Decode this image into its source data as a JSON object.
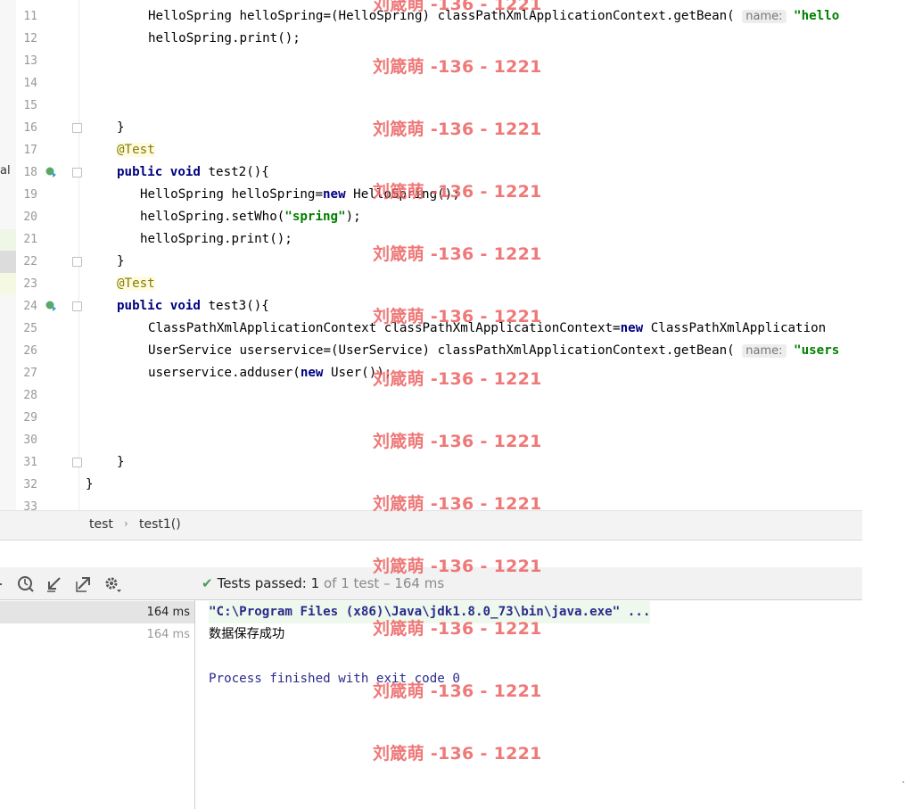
{
  "editor": {
    "left_glyph": "al",
    "lines": [
      {
        "n": "11",
        "indent": 70,
        "tokens": [
          {
            "t": "HelloSpring helloSpring=(HelloSpring) classPathXmlApplicationContext.getBean( ",
            "c": ""
          },
          {
            "t": "name:",
            "c": "hint"
          },
          {
            "t": " \"hello",
            "c": "str"
          }
        ]
      },
      {
        "n": "12",
        "indent": 70,
        "tokens": [
          {
            "t": "helloSpring.print();",
            "c": ""
          }
        ]
      },
      {
        "n": "13",
        "indent": 0,
        "tokens": []
      },
      {
        "n": "14",
        "indent": 0,
        "tokens": []
      },
      {
        "n": "15",
        "indent": 0,
        "tokens": []
      },
      {
        "n": "16",
        "indent": 35,
        "tokens": [
          {
            "t": "}",
            "c": ""
          }
        ]
      },
      {
        "n": "17",
        "indent": 35,
        "tokens": [
          {
            "t": "@Test",
            "c": "anno"
          }
        ]
      },
      {
        "n": "18",
        "indent": 35,
        "tokens": [
          {
            "t": "public ",
            "c": "kw"
          },
          {
            "t": "void ",
            "c": "kw"
          },
          {
            "t": "test2(){",
            "c": ""
          }
        ]
      },
      {
        "n": "19",
        "indent": 61,
        "tokens": [
          {
            "t": "HelloSpring helloSpring=",
            "c": ""
          },
          {
            "t": "new ",
            "c": "kw"
          },
          {
            "t": "HelloSpring();",
            "c": ""
          }
        ]
      },
      {
        "n": "20",
        "indent": 61,
        "tokens": [
          {
            "t": "helloSpring.setWho(",
            "c": ""
          },
          {
            "t": "\"spring\"",
            "c": "str"
          },
          {
            "t": ");",
            "c": ""
          }
        ]
      },
      {
        "n": "21",
        "indent": 61,
        "tokens": [
          {
            "t": "helloSpring.print();",
            "c": ""
          }
        ]
      },
      {
        "n": "22",
        "indent": 35,
        "tokens": [
          {
            "t": "}",
            "c": ""
          }
        ]
      },
      {
        "n": "23",
        "indent": 35,
        "tokens": [
          {
            "t": "@Test",
            "c": "anno"
          }
        ]
      },
      {
        "n": "24",
        "indent": 35,
        "tokens": [
          {
            "t": "public ",
            "c": "kw"
          },
          {
            "t": "void ",
            "c": "kw"
          },
          {
            "t": "test3(){",
            "c": ""
          }
        ]
      },
      {
        "n": "25",
        "indent": 70,
        "tokens": [
          {
            "t": "ClassPathXmlApplicationContext classPathXmlApplicationContext=",
            "c": ""
          },
          {
            "t": "new ",
            "c": "kw"
          },
          {
            "t": "ClassPathXmlApplication",
            "c": ""
          }
        ]
      },
      {
        "n": "26",
        "indent": 70,
        "tokens": [
          {
            "t": "UserService userservice=(UserService) classPathXmlApplicationContext.getBean( ",
            "c": ""
          },
          {
            "t": "name:",
            "c": "hint"
          },
          {
            "t": " \"users",
            "c": "str"
          }
        ]
      },
      {
        "n": "27",
        "indent": 70,
        "tokens": [
          {
            "t": "userservice.adduser(",
            "c": ""
          },
          {
            "t": "new ",
            "c": "kw"
          },
          {
            "t": "User());",
            "c": ""
          }
        ]
      },
      {
        "n": "28",
        "indent": 0,
        "tokens": []
      },
      {
        "n": "29",
        "indent": 0,
        "tokens": []
      },
      {
        "n": "30",
        "indent": 0,
        "tokens": []
      },
      {
        "n": "31",
        "indent": 35,
        "tokens": [
          {
            "t": "}",
            "c": ""
          }
        ]
      },
      {
        "n": "32",
        "indent": 0,
        "tokens": [
          {
            "t": "}",
            "c": ""
          }
        ]
      },
      {
        "n": "33",
        "indent": 0,
        "tokens": []
      }
    ]
  },
  "breadcrumb": {
    "items": [
      "test",
      "test1()"
    ]
  },
  "toolbar": {
    "icons": [
      "history-icon",
      "import-tests-icon",
      "export-tests-icon",
      "settings-icon"
    ]
  },
  "test_status": {
    "label": "Tests passed:",
    "passed": "1",
    "detail": "of 1 test – 164 ms"
  },
  "test_tree": {
    "rows": [
      {
        "time": "164 ms"
      },
      {
        "time": "164 ms"
      }
    ]
  },
  "console": {
    "command": "\"C:\\Program Files (x86)\\Java\\jdk1.8.0_73\\bin\\java.exe\" ...",
    "output": "数据保存成功",
    "exit": "Process finished with exit code 0"
  },
  "watermark": {
    "text": "刘箴萌 -136 - 1221"
  },
  "colors": {
    "keyword": "#000080",
    "string": "#008000",
    "annotation": "#808000",
    "passed_check": "#499c54",
    "watermark": "#ec6060"
  }
}
